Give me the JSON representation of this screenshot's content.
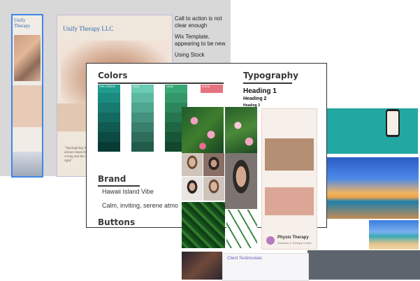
{
  "left_site": {
    "title": "Unify Therapy"
  },
  "main_site": {
    "title": "Unify Therapy LLC",
    "quote": "\"Apologizing does not always mean that you are wrong and the other person is right\""
  },
  "notes": [
    "Call to action is not clear enough",
    "Wix Template, appearing to be new",
    "Using Stock"
  ],
  "style_guide": {
    "colors_title": "Colors",
    "typography_title": "Typography",
    "heading1": "Heading 1",
    "heading2": "Heading 2",
    "heading3": "Heading 3",
    "brand_title": "Brand",
    "brand_line1": "Hawaii Island Vibe",
    "brand_line2": "Calm, inviting, serene atmo",
    "buttons_title": "Buttons",
    "swatches": [
      {
        "name": "SPA GREEN",
        "base": "#1f9c8f",
        "shades": [
          "#1f9c8f",
          "#1b8b80",
          "#187a70",
          "#146a61",
          "#105a52",
          "#0c4a43",
          "#093b35"
        ]
      },
      {
        "name": "TEAL",
        "base": "#6bcbb5",
        "shades": [
          "#6bcbb5",
          "#5db8a2",
          "#50a58f",
          "#44927d",
          "#38806b",
          "#2d6d5a",
          "#235b4a"
        ]
      },
      {
        "name": "JADE",
        "base": "#3aa876",
        "shades": [
          "#3aa876",
          "#339769",
          "#2c865c",
          "#25764f",
          "#1f6643",
          "#195638",
          "#13472d"
        ]
      },
      {
        "name": "ROSE",
        "base": "#e5747f",
        "shades": [
          "#e5747f",
          "#d06872",
          "#bb5c65",
          "#a65059",
          "#91454d",
          "#7d3a41",
          "#693036"
        ]
      }
    ]
  },
  "physio": {
    "name": "Physio Therapy",
    "sub": "Wellness & Therapy Center"
  },
  "testimonials": {
    "title": "Client Testimonials"
  }
}
